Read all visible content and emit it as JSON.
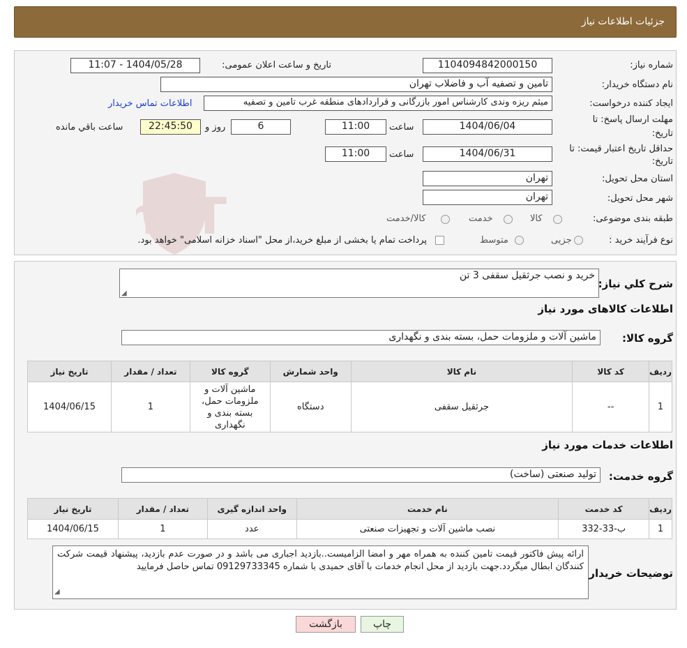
{
  "header": {
    "title": "جزئیات اطلاعات نیاز"
  },
  "info": {
    "need_number_label": "شماره نیاز:",
    "need_number": "1104094842000150",
    "announce_label": "تاریخ و ساعت اعلان عمومی:",
    "announce_value": "1404/05/28 - 11:07",
    "buyer_org_label": "نام دستگاه خریدار:",
    "buyer_org": "تامین و تصفیه آب و فاضلاب تهران",
    "requester_label": "ایجاد کننده درخواست:",
    "requester": "میثم ریزه وندی کارشناس امور بازرگانی و قراردادهای منطقه غرب تامین و تصفیه",
    "contact_link": "اطلاعات تماس خریدار",
    "deadline_label_1": "مهلت ارسال پاسخ: تا",
    "deadline_label_2": "تاریخ:",
    "deadline_date": "1404/06/04",
    "time_label": "ساعت",
    "deadline_time": "11:00",
    "days": "6",
    "days_label": "روز و",
    "remaining_time": "22:45:50",
    "remaining_label": "ساعت باقي مانده",
    "validity_label_1": "حداقل تاریخ اعتبار قیمت: تا",
    "validity_label_2": "تاریخ:",
    "validity_date": "1404/06/31",
    "validity_time": "11:00",
    "province_label": "استان محل تحویل:",
    "province": "تهران",
    "city_label": "شهر محل تحویل:",
    "city": "تهران",
    "category_label": "طبقه بندی موضوعی:",
    "category_options": [
      "کالا",
      "خدمت",
      "کالا/خدمت"
    ],
    "process_label": "نوع فرآیند خرید :",
    "process_options": [
      "جزیی",
      "متوسط"
    ],
    "process_note": "پرداخت تمام یا بخشی از مبلغ خرید،از محل \"اسناد خزانه اسلامی\" خواهد بود."
  },
  "watermark": {
    "text": "AriaTender.neT"
  },
  "summary": {
    "desc_label": "شرح کلي نیاز:",
    "desc_value": "خرید و نصب جرثقیل سقفی 3 تن",
    "goods_title": "اطلاعات کالاهای مورد نیاز",
    "goods_group_label": "گروه کالا:",
    "goods_group": "ماشین آلات و ملزومات حمل، بسته بندی و نگهداری"
  },
  "goods_table": {
    "headers": [
      "ردیف",
      "کد کالا",
      "نام کالا",
      "واحد شمارش",
      "گروه کالا",
      "تعداد / مقدار",
      "تاریخ نیاز"
    ],
    "rows": [
      [
        "1",
        "--",
        "جرثقیل سقفی",
        "دستگاه",
        "ماشین آلات و ملزومات حمل، بسته بندی و نگهداری",
        "1",
        "1404/06/15"
      ]
    ]
  },
  "services": {
    "title": "اطلاعات خدمات مورد نیاز",
    "group_label": "گروه خدمت:",
    "group": "تولید صنعتی (ساخت)"
  },
  "services_table": {
    "headers": [
      "ردیف",
      "کد خدمت",
      "نام خدمت",
      "واحد اندازه گیری",
      "تعداد / مقدار",
      "تاریخ نیاز"
    ],
    "rows": [
      [
        "1",
        "ب-33-332",
        "نصب ماشین آلات و تجهیزات صنعتی",
        "عدد",
        "1",
        "1404/06/15"
      ]
    ]
  },
  "buyer_notes": {
    "label": "توضیحات خریدار:",
    "text": "ارائه پیش فاکتور قیمت تامین کننده به همراه مهر و امضا الزامیست..بازدید اجباری می باشد و در صورت عدم بازدید، پیشنهاد قیمت شرکت کنندگان ابطال میگردد.جهت بازدید از محل انجام خدمات با آقای حمیدی با شماره 09129733345 تماس حاصل فرمایید"
  },
  "buttons": {
    "print": "چاپ",
    "back": "بازگشت"
  },
  "colors": {
    "header": "#8c6a3a",
    "back_button": "#fbd8d8",
    "print_button": "#e8f5e0",
    "link": "#1a3fcc"
  }
}
